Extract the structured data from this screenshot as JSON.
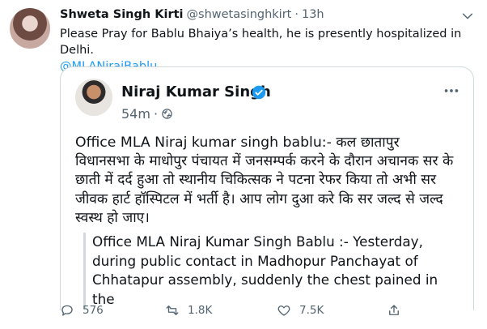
{
  "tweet": {
    "author_name": "Shweta Singh Kirti",
    "author_handle": "@shwetasinghkirt",
    "separator": "·",
    "time": "13h",
    "text": "Please Pray for Bablu Bhaiya’s health, he is presently hospitalized in Delhi.",
    "mention": "@MLANirajBablu"
  },
  "quoted_tweet": {
    "author_name": "Niraj Kumar Singh",
    "time": "54m",
    "separator": "·",
    "hindi_text": "Office MLA Niraj kumar singh bablu:- कल छातापुर विधानसभा के माधोपुर पंचायत में जनसम्पर्क करने के दौरान अचानक सर के छाती में दर्द हुआ तो स्थानीय चिकित्सक ने पटना रेफर किया तो अभी सर जीवक हार्ट हॉस्पिटल में भर्ती है। आप लोग दुआ करे कि सर जल्द से जल्द स्वस्थ हो जाए।",
    "nested_text": "Office MLA Niraj Kumar Singh Bablu :- Yesterday, during public contact in Madhopur Panchayat of Chhatapur assembly, suddenly the chest pained in the"
  },
  "actions": {
    "replies": "576",
    "retweets": "1.8K",
    "likes": "7.5K"
  },
  "icons": [
    "chevron-down-icon",
    "verified-badge-icon",
    "globe-icon",
    "more-icon",
    "reply-icon",
    "retweet-icon",
    "like-icon",
    "share-icon"
  ],
  "colors": {
    "accent": "#1d9bf0",
    "text": "#0f1419",
    "muted": "#536471",
    "border": "#cfd9de"
  }
}
